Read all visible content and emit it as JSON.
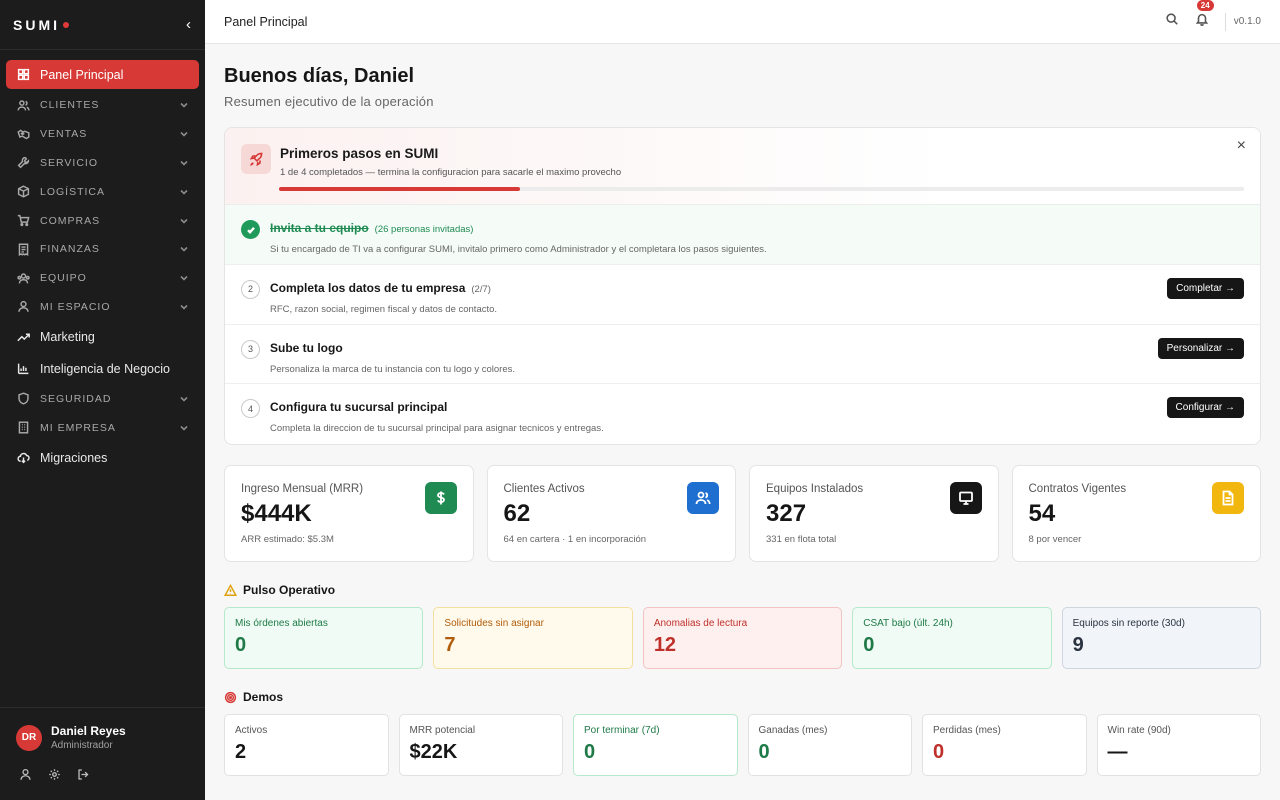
{
  "brand": {
    "name": "SUMI"
  },
  "sidebar": {
    "items": [
      {
        "label": "Panel Principal",
        "icon": "dashboard-icon"
      },
      {
        "label": "CLIENTES",
        "icon": "users-icon"
      },
      {
        "label": "VENTAS",
        "icon": "handshake-icon"
      },
      {
        "label": "SERVICIO",
        "icon": "wrench-icon"
      },
      {
        "label": "LOGÍSTICA",
        "icon": "box-icon"
      },
      {
        "label": "COMPRAS",
        "icon": "cart-icon"
      },
      {
        "label": "FINANZAS",
        "icon": "receipt-icon"
      },
      {
        "label": "EQUIPO",
        "icon": "team-icon"
      },
      {
        "label": "MI ESPACIO",
        "icon": "user-icon"
      },
      {
        "label": "Marketing",
        "icon": "trending-icon"
      },
      {
        "label": "Inteligencia de Negocio",
        "icon": "bar-chart-icon"
      },
      {
        "label": "SEGURIDAD",
        "icon": "shield-icon"
      },
      {
        "label": "MI EMPRESA",
        "icon": "building-icon"
      },
      {
        "label": "Migraciones",
        "icon": "cloud-icon"
      }
    ],
    "user": {
      "initials": "DR",
      "name": "Daniel Reyes",
      "role": "Administrador"
    }
  },
  "topbar": {
    "title": "Panel Principal",
    "notifications": "24",
    "version": "v0.1.0"
  },
  "header": {
    "greeting": "Buenos días, Daniel",
    "subtitle": "Resumen ejecutivo de la operación"
  },
  "onboarding": {
    "title": "Primeros pasos en SUMI",
    "subtitle": "1 de 4 completados — termina la configuracion para sacarle el maximo provecho",
    "progress_percent": 25,
    "close": "×",
    "steps": [
      {
        "num": "1",
        "title": "Invita a tu equipo",
        "extra": "(26 personas invitadas)",
        "desc": "Si tu encargado de TI va a configurar SUMI, invitalo primero como Administrador y el completara los pasos siguientes.",
        "done": true,
        "button": ""
      },
      {
        "num": "2",
        "title": "Completa los datos de tu empresa",
        "extra": "(2/7)",
        "desc": "RFC, razon social, regimen fiscal y datos de contacto.",
        "done": false,
        "button": "Completar →"
      },
      {
        "num": "3",
        "title": "Sube tu logo",
        "extra": "",
        "desc": "Personaliza la marca de tu instancia con tu logo y colores.",
        "done": false,
        "button": "Personalizar →"
      },
      {
        "num": "4",
        "title": "Configura tu sucursal principal",
        "extra": "",
        "desc": "Completa la direccion de tu sucursal principal para asignar tecnicos y entregas.",
        "done": false,
        "button": "Configurar →"
      }
    ]
  },
  "kpis": [
    {
      "label": "Ingreso Mensual (MRR)",
      "value": "$444K",
      "sub": "ARR estimado: $5.3M",
      "color": "#1f8a52",
      "icon": "dollar-icon"
    },
    {
      "label": "Clientes Activos",
      "value": "62",
      "sub": "64 en cartera · 1 en incorporación",
      "color": "#1f6fd1",
      "icon": "users-icon"
    },
    {
      "label": "Equipos Instalados",
      "value": "327",
      "sub": "331 en flota total",
      "color": "#161616",
      "icon": "monitor-icon"
    },
    {
      "label": "Contratos Vigentes",
      "value": "54",
      "sub": "8 por vencer",
      "color": "#f2b70f",
      "icon": "document-icon"
    }
  ],
  "pulse": {
    "title": "Pulso Operativo",
    "cards": [
      {
        "label": "Mis órdenes abiertas",
        "value": "0",
        "bg": "#effbf4",
        "border": "#b6e8cb",
        "color": "#1f7a48"
      },
      {
        "label": "Solicitudes sin asignar",
        "value": "7",
        "bg": "#fffaeb",
        "border": "#f3dfa0",
        "color": "#b15c0b"
      },
      {
        "label": "Anomalias de lectura",
        "value": "12",
        "bg": "#fdf0ef",
        "border": "#f1c4c1",
        "color": "#c0302b"
      },
      {
        "label": "CSAT bajo (últ. 24h)",
        "value": "0",
        "bg": "#effbf4",
        "border": "#b6e8cb",
        "color": "#1f7a48"
      },
      {
        "label": "Equipos sin reporte (30d)",
        "value": "9",
        "bg": "#f1f4f8",
        "border": "#cfd6df",
        "color": "#2a3340"
      }
    ]
  },
  "demos": {
    "title": "Demos",
    "cards": [
      {
        "label": "Activos",
        "value": "2",
        "color": "#161616",
        "border": "#e2e2e2"
      },
      {
        "label": "MRR potencial",
        "value": "$22K",
        "color": "#161616",
        "border": "#e2e2e2"
      },
      {
        "label": "Por terminar (7d)",
        "value": "0",
        "color": "#1f7a48",
        "border": "#b6e8cb"
      },
      {
        "label": "Ganadas (mes)",
        "value": "0",
        "color": "#1f7a48",
        "border": "#e2e2e2"
      },
      {
        "label": "Perdidas (mes)",
        "value": "0",
        "color": "#c0302b",
        "border": "#e2e2e2"
      },
      {
        "label": "Win rate (90d)",
        "value": "—",
        "color": "#161616",
        "border": "#e2e2e2"
      }
    ]
  }
}
